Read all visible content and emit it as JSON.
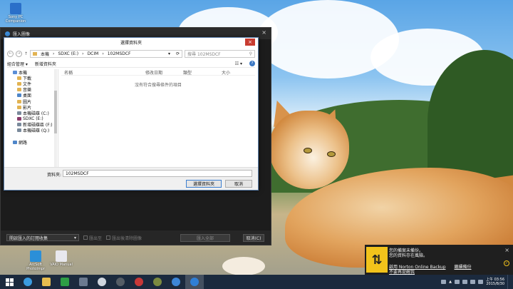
{
  "desktop": {
    "icons": [
      {
        "label": "Sony PC Companion",
        "icon": "sony-pc-companion-icon",
        "color": "#2a6fc9"
      },
      {
        "label": "ArcSoft PhotoImpr",
        "icon": "arcsoft-photoimpression-icon",
        "color": "#2b8fd8"
      },
      {
        "label": "VAIO Manual",
        "icon": "vaio-manual-icon",
        "color": "#e8e8ee"
      }
    ]
  },
  "import_window": {
    "title": "匯入圖像",
    "close_glyph": "×",
    "bottom": {
      "open_select": "開啟匯入的訂閱收集",
      "check_1": "匯出至",
      "check_2": "匯出後清除圖像",
      "import_all": "匯入全部",
      "cancel": "取消(C)"
    }
  },
  "folder_dialog": {
    "title": "選擇資料夾",
    "close_glyph": "×",
    "path": [
      "本機",
      "SDXC (E:)",
      "DCIM",
      "102MSDCF"
    ],
    "search_placeholder": "搜尋 102MSDCF",
    "toolbar": {
      "organize": "組合管理 ▾",
      "new_folder": "新增資料夾"
    },
    "nav": [
      {
        "label": "本機",
        "color": "#5b8ed6"
      },
      {
        "label": "下載",
        "color": "#e2b352"
      },
      {
        "label": "文件",
        "color": "#e2b352"
      },
      {
        "label": "音樂",
        "color": "#e2b352"
      },
      {
        "label": "桌面",
        "color": "#4f86c9"
      },
      {
        "label": "圖片",
        "color": "#e2b352"
      },
      {
        "label": "影片",
        "color": "#e2b352"
      },
      {
        "label": "本機磁碟 (C:)",
        "color": "#7a8a9c"
      },
      {
        "label": "SDXC (E:)",
        "color": "#8a3b6b"
      },
      {
        "label": "新增磁碟區 (F:)",
        "color": "#7a8a9c"
      },
      {
        "label": "本機磁碟 (Q:)",
        "color": "#7a8a9c"
      },
      {
        "label": "",
        "color": "transparent"
      },
      {
        "label": "網路",
        "color": "#4f86c9"
      }
    ],
    "columns": [
      "名稱",
      "修改日期",
      "類型",
      "大小"
    ],
    "empty_message": "沒有符合搜尋條件的項目",
    "folder_label": "資料夾:",
    "folder_value": "102MSDCF",
    "select_button": "選擇資料夾",
    "cancel_button": "取消"
  },
  "norton": {
    "line1": "您的備案未備份。",
    "line2": "您的資料存在風險。",
    "link_enable": "啟用 Norton Online Backup",
    "link_continue": "繼續備份",
    "dismiss": "不要再提醒我",
    "close_glyph": "×"
  },
  "taskbar": {
    "apps": [
      {
        "icon": "windows-start-icon",
        "color": "transparent"
      },
      {
        "icon": "internet-explorer-icon",
        "color": "#3a9be0"
      },
      {
        "icon": "file-explorer-icon",
        "color": "#e7bd4f"
      },
      {
        "icon": "store-icon",
        "color": "#2e9e45"
      },
      {
        "icon": "app-grid-icon",
        "color": "#6b7a90"
      },
      {
        "icon": "media-player-icon",
        "color": "#cfd6df"
      },
      {
        "icon": "camera-app-icon",
        "color": "#555d66"
      },
      {
        "icon": "vaio-care-icon",
        "color": "#c73838"
      },
      {
        "icon": "music-app-icon",
        "color": "#7b8a40"
      },
      {
        "icon": "settings-app-icon",
        "color": "#3d86d8"
      },
      {
        "icon": "photo-import-icon",
        "color": "#2f7fd6"
      }
    ],
    "clock_time": "上午 03:56",
    "clock_date": "2015/8/30"
  }
}
